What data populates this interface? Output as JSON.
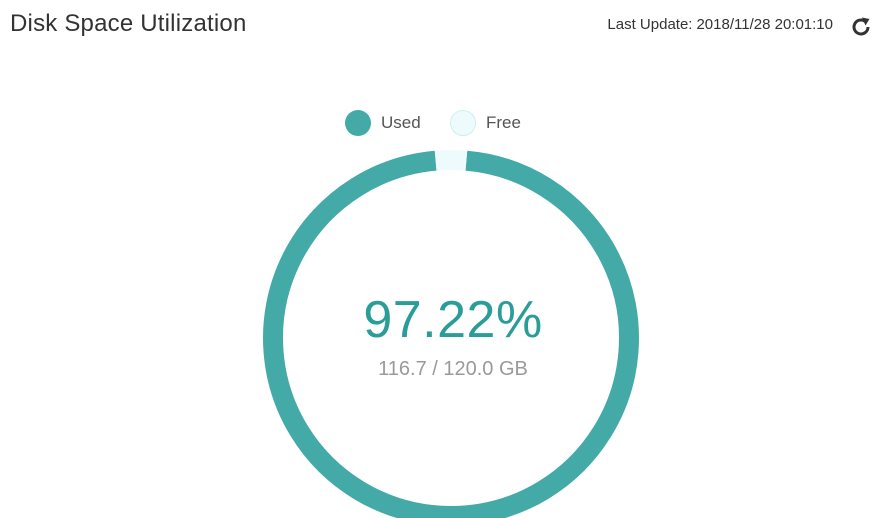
{
  "header": {
    "title": "Disk Space Utilization",
    "last_update_label": "Last Update:",
    "last_update_value": "2018/11/28 20:01:10",
    "refresh_icon": "refresh-icon"
  },
  "legend": {
    "used_label": "Used",
    "free_label": "Free"
  },
  "summary": {
    "percent_text": "97.22%",
    "usage_text": "116.7 / 120.0 GB"
  },
  "colors": {
    "used": "#44aaa7",
    "free": "#eefbfd",
    "free_border": "#cfeef0",
    "percent_text": "#2a9d99"
  },
  "chart_data": {
    "type": "pie",
    "categories": [
      "Used",
      "Free"
    ],
    "values": [
      116.7,
      3.3
    ],
    "unit": "GB",
    "total": 120.0,
    "used_fraction": 0.9722,
    "title": "Disk Space Utilization",
    "legend_position": "top-center"
  }
}
